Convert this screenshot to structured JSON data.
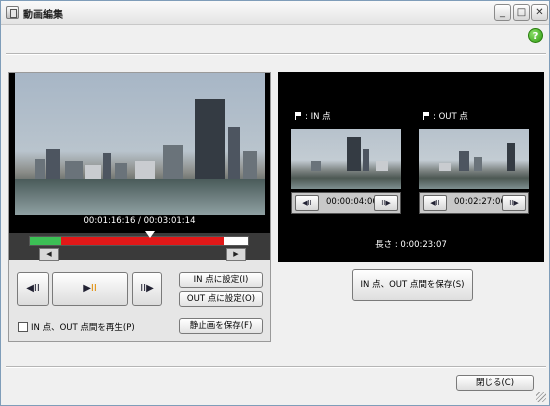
{
  "window": {
    "title": "動画編集",
    "minimize_glyph": "_",
    "maximize_glyph": "□",
    "close_glyph": "✕",
    "help_glyph": "?"
  },
  "preview": {
    "timecode": "00:01:16:16 / 00:03:01:14",
    "timeline": {
      "in_fraction": 0.14,
      "out_fraction": 0.89,
      "position_fraction": 0.55
    },
    "colors": {
      "in_segment": "#3cbf55",
      "selected_segment": "#e01818"
    }
  },
  "controls": {
    "prev_frame": "◀II",
    "play_pause": "▶",
    "pause_glyph": "II",
    "next_frame": "II▶",
    "set_in_button": "IN 点に設定(I)",
    "set_out_button": "OUT 点に設定(O)",
    "save_still_button": "静止画を保存(F)",
    "play_range_checkbox": "IN 点、OUT 点間を再生(P)"
  },
  "in_point": {
    "label": ": IN 点",
    "time": "00:00:04:00",
    "prev": "◀II",
    "next": "II▶"
  },
  "out_point": {
    "label": ": OUT 点",
    "time": "00:02:27:06",
    "prev": "◀II",
    "next": "II▶"
  },
  "length": "長さ : 0:00:23:07",
  "save_io_button": "IN 点、OUT 点間を保存(S)",
  "close_button": "閉じる(C)"
}
